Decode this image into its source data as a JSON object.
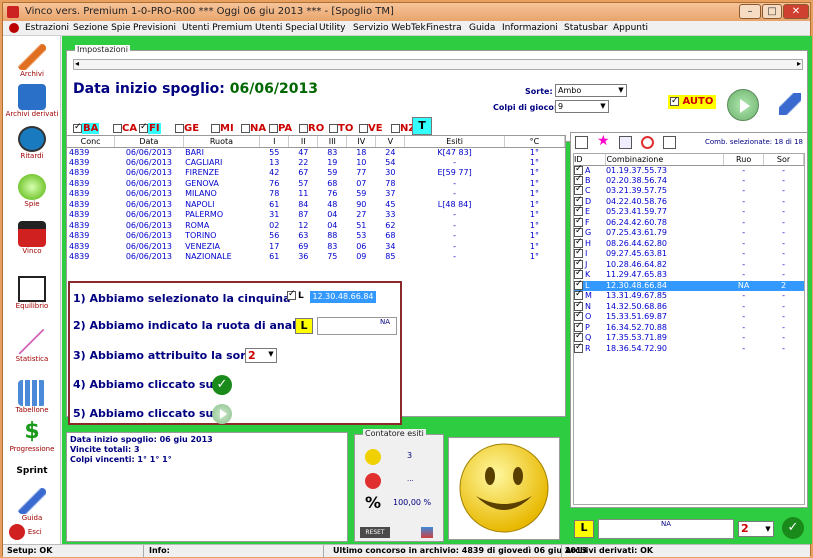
{
  "title": "Vinco vers. Premium  1-0-PRO-R00  ***  Oggi 06 giu 2013  ***   - [Spoglio TM]",
  "menu": [
    "Estrazioni",
    "Sezione Spie",
    "Previsioni",
    "Utenti Premium",
    "Utenti Special",
    "Utility",
    "Servizio WebTek",
    "Finestra",
    "Guida",
    "Informazioni",
    "Statusbar",
    "Appunti"
  ],
  "sidebar": [
    "Archivi",
    "Archivi derivati",
    "Ritardi",
    "Spie",
    "Vinco",
    "Equilibrio",
    "Statistica",
    "Tabellone",
    "Progressione",
    "Sprint",
    "Guida",
    "Esci"
  ],
  "impostazioni": {
    "legend": "Impostazioni",
    "date_label": "Data inizio spoglio:",
    "date_value": "06/06/2013",
    "sorte_label": "Sorte:",
    "sorte_value": "Ambo",
    "colpi_label": "Colpi di gioco:",
    "colpi_value": "9",
    "auto_label": "AUTO",
    "t_button": "T",
    "ruote": [
      {
        "code": "BA",
        "checked": true
      },
      {
        "code": "CA",
        "checked": false
      },
      {
        "code": "FI",
        "checked": true
      },
      {
        "code": "GE",
        "checked": false
      },
      {
        "code": "MI",
        "checked": false
      },
      {
        "code": "NA",
        "checked": false
      },
      {
        "code": "PA",
        "checked": false
      },
      {
        "code": "RO",
        "checked": false
      },
      {
        "code": "TO",
        "checked": false
      },
      {
        "code": "VE",
        "checked": false
      },
      {
        "code": "NZ",
        "checked": false
      }
    ]
  },
  "table": {
    "headers": [
      "Conc",
      "Data",
      "Ruota",
      "I",
      "II",
      "III",
      "IV",
      "V",
      "Esiti",
      "°C"
    ],
    "rows": [
      [
        "4839",
        "06/06/2013",
        "BARI",
        "55",
        "47",
        "83",
        "18",
        "24",
        "K[47 83]",
        "1°"
      ],
      [
        "4839",
        "06/06/2013",
        "CAGLIARI",
        "13",
        "22",
        "19",
        "10",
        "54",
        "-",
        "1°"
      ],
      [
        "4839",
        "06/06/2013",
        "FIRENZE",
        "42",
        "67",
        "59",
        "77",
        "30",
        "E[59 77]",
        "1°"
      ],
      [
        "4839",
        "06/06/2013",
        "GENOVA",
        "76",
        "57",
        "68",
        "07",
        "78",
        "-",
        "1°"
      ],
      [
        "4839",
        "06/06/2013",
        "MILANO",
        "78",
        "11",
        "76",
        "59",
        "37",
        "-",
        "1°"
      ],
      [
        "4839",
        "06/06/2013",
        "NAPOLI",
        "61",
        "84",
        "48",
        "90",
        "45",
        "L[48 84]",
        "1°"
      ],
      [
        "4839",
        "06/06/2013",
        "PALERMO",
        "31",
        "87",
        "04",
        "27",
        "33",
        "-",
        "1°"
      ],
      [
        "4839",
        "06/06/2013",
        "ROMA",
        "02",
        "12",
        "04",
        "51",
        "62",
        "-",
        "1°"
      ],
      [
        "4839",
        "06/06/2013",
        "TORINO",
        "56",
        "63",
        "88",
        "53",
        "68",
        "-",
        "1°"
      ],
      [
        "4839",
        "06/06/2013",
        "VENEZIA",
        "17",
        "69",
        "83",
        "06",
        "34",
        "-",
        "1°"
      ],
      [
        "4839",
        "06/06/2013",
        "NAZIONALE",
        "61",
        "36",
        "75",
        "09",
        "85",
        "-",
        "1°"
      ]
    ]
  },
  "steps": {
    "s1": "1) Abbiamo selezionato la cinquina",
    "s1_l": "L",
    "s1_combo": "12.30.48.66.84",
    "s2": "2) Abbiamo indicato la ruota di analisi",
    "s2_l": "L",
    "s2_na": "NA",
    "s3": "3) Abbiamo attribuito la sorte",
    "s3_val": "2",
    "s4": "4) Abbiamo cliccato su",
    "s5": "5) Abbiamo cliccato su"
  },
  "summary": {
    "line1": "Data inizio spoglio: 06 giu 2013",
    "line2": "Vincite totali: 3",
    "line3": "Colpi vincenti: 1° 1° 1°"
  },
  "contatore": {
    "legend": "Contatore esiti",
    "happy": "3",
    "sad": "...",
    "pct": "100,00 %",
    "reset": "RESET"
  },
  "combo": {
    "selected_info": "Comb. selezionate: 18 di 18",
    "headers": [
      "ID",
      "Combinazione",
      "Ruo",
      "Sor"
    ],
    "rows": [
      [
        "A",
        "01.19.37.55.73",
        "-",
        "-"
      ],
      [
        "B",
        "02.20.38.56.74",
        "-",
        "-"
      ],
      [
        "C",
        "03.21.39.57.75",
        "-",
        "-"
      ],
      [
        "D",
        "04.22.40.58.76",
        "-",
        "-"
      ],
      [
        "E",
        "05.23.41.59.77",
        "-",
        "-"
      ],
      [
        "F",
        "06.24.42.60.78",
        "-",
        "-"
      ],
      [
        "G",
        "07.25.43.61.79",
        "-",
        "-"
      ],
      [
        "H",
        "08.26.44.62.80",
        "-",
        "-"
      ],
      [
        "I",
        "09.27.45.63.81",
        "-",
        "-"
      ],
      [
        "J",
        "10.28.46.64.82",
        "-",
        "-"
      ],
      [
        "K",
        "11.29.47.65.83",
        "-",
        "-"
      ],
      [
        "L",
        "12.30.48.66.84",
        "NA",
        "2"
      ],
      [
        "M",
        "13.31.49.67.85",
        "-",
        "-"
      ],
      [
        "N",
        "14.32.50.68.86",
        "-",
        "-"
      ],
      [
        "O",
        "15.33.51.69.87",
        "-",
        "-"
      ],
      [
        "P",
        "16.34.52.70.88",
        "-",
        "-"
      ],
      [
        "Q",
        "17.35.53.71.89",
        "-",
        "-"
      ],
      [
        "R",
        "18.36.54.72.90",
        "-",
        "-"
      ]
    ],
    "bottom_l": "L",
    "bottom_na": "NA",
    "bottom_sorte": "2"
  },
  "status": {
    "setup": "Setup: OK",
    "info": "Info:",
    "ultimo": "Ultimo concorso in archivio: 4839 di giovedì 06 giu 2013",
    "derivati": "Archivi derivati: OK"
  },
  "colors": {
    "accent_green": "#2ecc40",
    "title_orange": "#e9a46c",
    "highlight_blue": "#3399ff"
  }
}
